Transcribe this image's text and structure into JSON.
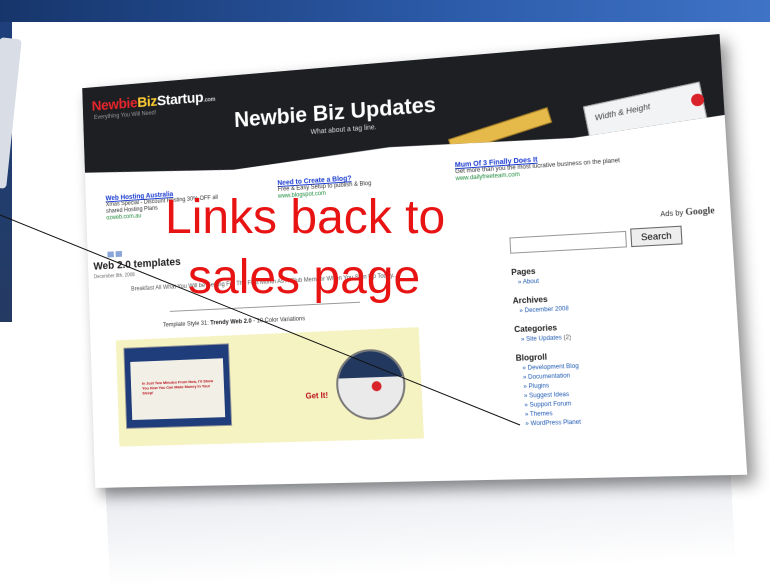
{
  "blog": {
    "logo_part1": "Newbie",
    "logo_part2": "Biz",
    "logo_part3": "Startup",
    "logo_tld": ".com",
    "logo_tagline": "Everything You Will Need!",
    "title": "Newbie Biz Updates",
    "subtitle": "What about a tag line.",
    "notepad_text": "Width & Height"
  },
  "ads": [
    {
      "title": "Web Hosting Australia",
      "text": "Xmas Special - Discount Hosting 30% OFF all shared Hosting Plans",
      "url": "ozweb.com.au"
    },
    {
      "title": "Need to Create a Blog?",
      "text": "Free & Easy Setup to publish & Blog",
      "url": "www.blogspot.com"
    },
    {
      "title": "Mum Of 3 Finally Does It",
      "text": "Get more than you the most lucrative business on the planet",
      "url": "www.dailyfreeteam.com"
    }
  ],
  "ads_by": "Ads by",
  "ads_by_brand": "Google",
  "post": {
    "title": "Web 2.0 templates",
    "date": "December 8th, 2008",
    "text": "Breakfast All What You Will be Getting For The First Month As A Club Member When You Sign Up Today...",
    "caption_prefix": "Template Style 31:",
    "caption_bold": "Trendy Web 2.0",
    "caption_suffix": "- 10 Color Variations",
    "inner_red_text": "In Just Two Minutes From Now, I'll Show You How You Can Make Money In Your Sleep!",
    "get_it": "Get It!"
  },
  "sidebar": {
    "search_button": "Search",
    "pages_head": "Pages",
    "pages": [
      "About"
    ],
    "archives_head": "Archives",
    "archives": [
      "December 2008"
    ],
    "categories_head": "Categories",
    "categories": [
      {
        "label": "Site Updates",
        "count": "(2)"
      }
    ],
    "blogroll_head": "Blogroll",
    "blogroll": [
      "Development Blog",
      "Documentation",
      "Plugins",
      "Suggest Ideas",
      "Support Forum",
      "Themes",
      "WordPress Planet"
    ]
  },
  "annotation": {
    "line1": "Links back to",
    "line2": "sales page",
    "color": "#e81414"
  }
}
